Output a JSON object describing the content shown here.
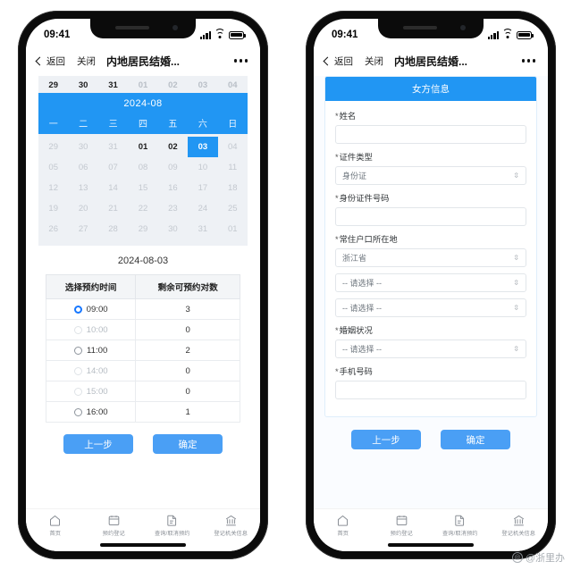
{
  "status_bar": {
    "time": "09:41",
    "icons": [
      "signal-icon",
      "wifi-icon",
      "battery-icon"
    ]
  },
  "nav": {
    "back_label": "返回",
    "close_label": "关闭",
    "title": "内地居民结婚...",
    "more_label": "•••"
  },
  "left_screen": {
    "calendar": {
      "prev_strip": [
        {
          "d": "29",
          "dark": true
        },
        {
          "d": "30",
          "dark": true
        },
        {
          "d": "31",
          "dark": true
        },
        {
          "d": "01",
          "dark": false
        },
        {
          "d": "02",
          "dark": false
        },
        {
          "d": "03",
          "dark": false
        },
        {
          "d": "04",
          "dark": false
        }
      ],
      "month_label": "2024-08",
      "weekdays": [
        "一",
        "二",
        "三",
        "四",
        "五",
        "六",
        "日"
      ],
      "rows": [
        [
          {
            "d": "29",
            "s": "muted"
          },
          {
            "d": "30",
            "s": "muted"
          },
          {
            "d": "31",
            "s": "muted"
          },
          {
            "d": "01",
            "s": "avail"
          },
          {
            "d": "02",
            "s": "avail"
          },
          {
            "d": "03",
            "s": "sel"
          },
          {
            "d": "04",
            "s": "muted"
          }
        ],
        [
          {
            "d": "05",
            "s": "muted"
          },
          {
            "d": "06",
            "s": "muted"
          },
          {
            "d": "07",
            "s": "muted"
          },
          {
            "d": "08",
            "s": "muted"
          },
          {
            "d": "09",
            "s": "muted"
          },
          {
            "d": "10",
            "s": "muted"
          },
          {
            "d": "11",
            "s": "muted"
          }
        ],
        [
          {
            "d": "12",
            "s": "muted"
          },
          {
            "d": "13",
            "s": "muted"
          },
          {
            "d": "14",
            "s": "muted"
          },
          {
            "d": "15",
            "s": "muted"
          },
          {
            "d": "16",
            "s": "muted"
          },
          {
            "d": "17",
            "s": "muted"
          },
          {
            "d": "18",
            "s": "muted"
          }
        ],
        [
          {
            "d": "19",
            "s": "muted"
          },
          {
            "d": "20",
            "s": "muted"
          },
          {
            "d": "21",
            "s": "muted"
          },
          {
            "d": "22",
            "s": "muted"
          },
          {
            "d": "23",
            "s": "muted"
          },
          {
            "d": "24",
            "s": "muted"
          },
          {
            "d": "25",
            "s": "muted"
          }
        ],
        [
          {
            "d": "26",
            "s": "muted"
          },
          {
            "d": "27",
            "s": "muted"
          },
          {
            "d": "28",
            "s": "muted"
          },
          {
            "d": "29",
            "s": "muted"
          },
          {
            "d": "30",
            "s": "muted"
          },
          {
            "d": "31",
            "s": "muted"
          },
          {
            "d": "01",
            "s": "muted"
          }
        ]
      ]
    },
    "selected_date": "2024-08-03",
    "slot_table": {
      "headers": [
        "选择预约时间",
        "剩余可预约对数"
      ],
      "rows": [
        {
          "time": "09:00",
          "remaining": "3",
          "selected": true,
          "disabled": false
        },
        {
          "time": "10:00",
          "remaining": "0",
          "selected": false,
          "disabled": true
        },
        {
          "time": "11:00",
          "remaining": "2",
          "selected": false,
          "disabled": false
        },
        {
          "time": "14:00",
          "remaining": "0",
          "selected": false,
          "disabled": true
        },
        {
          "time": "15:00",
          "remaining": "0",
          "selected": false,
          "disabled": true
        },
        {
          "time": "16:00",
          "remaining": "1",
          "selected": false,
          "disabled": false
        }
      ]
    },
    "buttons": {
      "prev": "上一步",
      "confirm": "确定"
    }
  },
  "right_screen": {
    "form_title": "女方信息",
    "fields": [
      {
        "label": "姓名",
        "required": true,
        "type": "input",
        "value": "",
        "placeholder": ""
      },
      {
        "label": "证件类型",
        "required": true,
        "type": "select",
        "value": "身份证"
      },
      {
        "label": "身份证件号码",
        "required": true,
        "type": "input",
        "value": "",
        "placeholder": ""
      },
      {
        "label": "常住户口所在地",
        "required": true,
        "type": "select",
        "value": "浙江省"
      },
      {
        "label": "",
        "required": false,
        "type": "select",
        "value": "-- 请选择 --"
      },
      {
        "label": "",
        "required": false,
        "type": "select",
        "value": "-- 请选择 --"
      },
      {
        "label": "婚姻状况",
        "required": true,
        "type": "select",
        "value": "-- 请选择 --"
      },
      {
        "label": "手机号码",
        "required": true,
        "type": "input",
        "value": "",
        "placeholder": ""
      }
    ],
    "buttons": {
      "prev": "上一步",
      "confirm": "确定"
    }
  },
  "tabbar": [
    {
      "icon": "home-icon",
      "label": "首页"
    },
    {
      "icon": "calendar-icon",
      "label": "预约登记"
    },
    {
      "icon": "document-icon",
      "label": "查询/取消预约"
    },
    {
      "icon": "bank-icon",
      "label": "登记机关信息"
    }
  ],
  "watermark": {
    "text": "@浙里办",
    "icon": "weibo-icon"
  },
  "colors": {
    "accent": "#2196f3",
    "button": "#4a9ff5",
    "radio_active": "#1677ff",
    "calendar_bg": "#eef1f5"
  }
}
